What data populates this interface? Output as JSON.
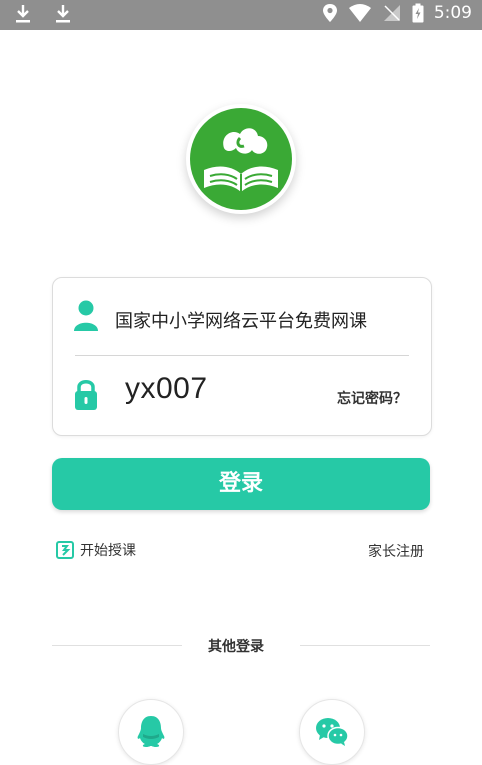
{
  "status_bar": {
    "time": "5:09",
    "left_icons": [
      "download-icon",
      "download-icon"
    ],
    "right_icons": [
      "location-icon",
      "wifi-icon",
      "signal-icon",
      "battery-icon"
    ]
  },
  "logo": {
    "icon": "book-cloud-logo"
  },
  "login": {
    "username_value": "国家中小学网络云平台免费网课",
    "password_value": "yx007",
    "forgot_label": "忘记密码？",
    "submit_label": "登录"
  },
  "links": {
    "start_class_label": "开始授课",
    "parent_register_label": "家长注册"
  },
  "other_login": {
    "label": "其他登录",
    "options": [
      "qq-icon",
      "wechat-icon"
    ]
  },
  "colors": {
    "accent": "#26c9a6",
    "logo_green": "#3aa935",
    "status_bar": "#8f8f8f"
  }
}
